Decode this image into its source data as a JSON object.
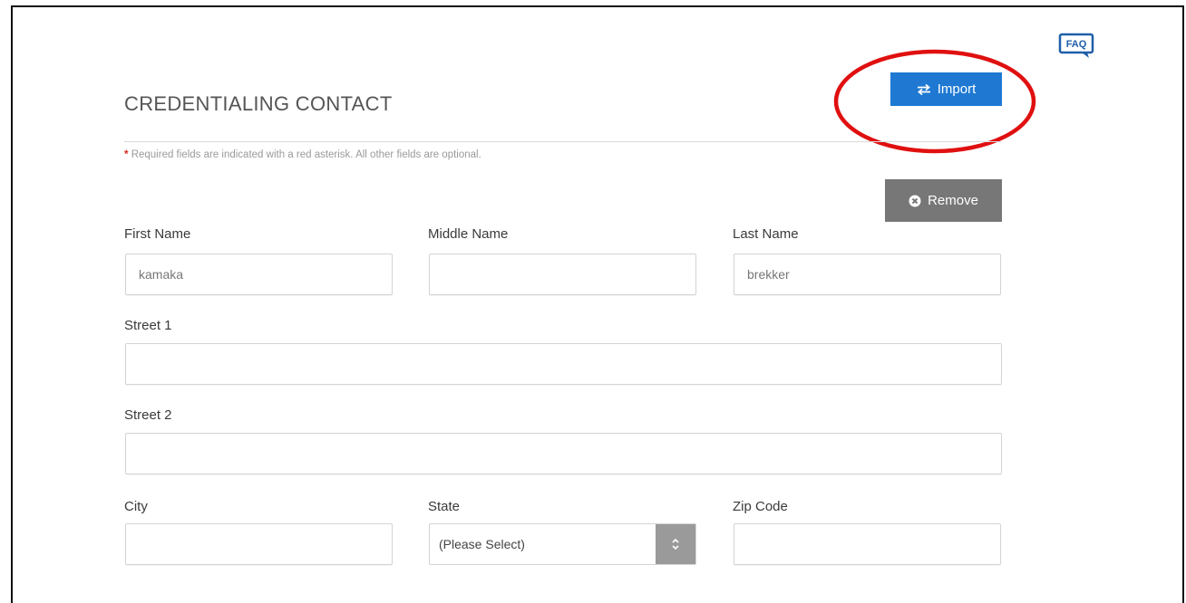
{
  "section": {
    "title": "CREDENTIALING CONTACT",
    "required_asterisk": "*",
    "required_note": "Required fields are indicated with a red asterisk. All other fields are optional."
  },
  "help": {
    "faq_label": "FAQ"
  },
  "buttons": {
    "import_label": "Import",
    "import_icon": "swap-arrows-icon",
    "remove_label": "Remove",
    "remove_icon": "times-circle-icon"
  },
  "form": {
    "first_name": {
      "label": "First Name",
      "value": "kamaka"
    },
    "middle_name": {
      "label": "Middle Name",
      "value": ""
    },
    "last_name": {
      "label": "Last Name",
      "value": "brekker"
    },
    "street1": {
      "label": "Street 1",
      "value": ""
    },
    "street2": {
      "label": "Street 2",
      "value": ""
    },
    "city": {
      "label": "City",
      "value": ""
    },
    "state": {
      "label": "State",
      "value": "(Please Select)"
    },
    "zip": {
      "label": "Zip Code",
      "value": ""
    }
  },
  "colors": {
    "primary": "#1f79d2",
    "remove": "#777777",
    "annotation": "#e01010",
    "required": "#d9251c"
  }
}
